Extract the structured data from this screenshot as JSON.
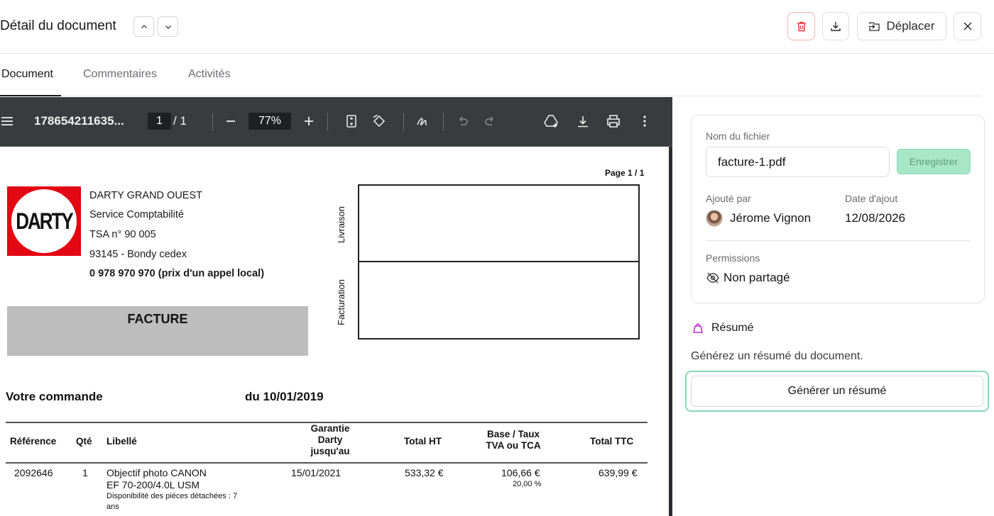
{
  "header": {
    "title": "Détail du document",
    "move_label": "Déplacer"
  },
  "tabs": [
    {
      "label": "Document",
      "active": true
    },
    {
      "label": "Commentaires",
      "active": false
    },
    {
      "label": "Activités",
      "active": false
    }
  ],
  "viewer": {
    "filename": "178654211635...",
    "page_current": "1",
    "page_total": "/ 1",
    "zoom": "77%",
    "dark_toolbar_color": "#3a3b3e"
  },
  "document": {
    "page_label": "Page 1 / 1",
    "logo_text": "DARTY",
    "address_lines": [
      "DARTY GRAND OUEST",
      "Service Comptabilité",
      "TSA n° 90 005",
      "93145 - Bondy cedex"
    ],
    "phone_line": "0 978 970 970 (prix d'un appel local)",
    "facture_label": "FACTURE",
    "livraison_label": "Livraison",
    "facturation_label": "Facturation",
    "order_title": "Votre commande",
    "order_date": "du 10/01/2019",
    "table": {
      "headers": [
        "Référence",
        "Qté",
        "Libellé",
        "Garantie Darty jusqu'au",
        "Total HT",
        "Base / Taux TVA ou TCA",
        "Total TTC"
      ],
      "header_garantie_lines": [
        "Garantie",
        "Darty",
        "jusqu'au"
      ],
      "header_tva_lines": [
        "Base / Taux",
        "TVA ou TCA"
      ],
      "row": {
        "reference": "2092646",
        "qty": "1",
        "libelle_line1": "Objectif photo CANON",
        "libelle_line2": "EF 70-200/4.0L USM",
        "libelle_note1": "Disponibilité des pièces détachées : 7",
        "libelle_note2": "ans",
        "garantie": "15/01/2021",
        "total_ht": "533,32 €",
        "tva_base": "106,66 €",
        "tva_rate": "20,00 %",
        "total_ttc": "639,99 €"
      }
    }
  },
  "panel": {
    "filename_label": "Nom du fichier",
    "filename_value": "facture-1.pdf",
    "save_label": "Enregistrer",
    "added_by_label": "Ajouté par",
    "added_by_value": "Jérome Vignon",
    "added_date_label": "Date d'ajout",
    "added_date_value": "12/08/2026",
    "permissions_label": "Permissions",
    "permissions_value": "Non partagé",
    "resume_title": "Résumé",
    "resume_desc": "Générez un résumé du document.",
    "generate_label": "Générer un résumé",
    "accent_color": "#84d9b3",
    "delete_color": "#e03a3a"
  }
}
